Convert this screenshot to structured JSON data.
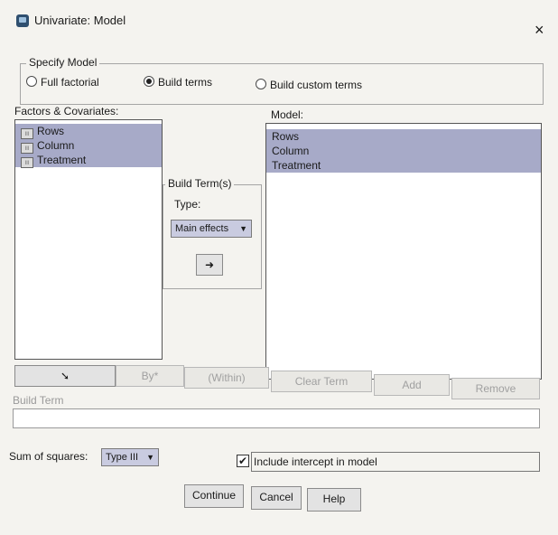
{
  "window": {
    "title": "Univariate: Model",
    "close_label": "×"
  },
  "specify_model": {
    "legend": "Specify Model",
    "options": [
      "Full factorial",
      "Build terms",
      "Build custom terms"
    ],
    "selected": "Build terms"
  },
  "factors": {
    "label": "Factors & Covariates:",
    "items": [
      "Rows",
      "Column",
      "Treatment"
    ]
  },
  "build_terms": {
    "legend": "Build Term(s)",
    "type_label": "Type:",
    "type_value": "Main effects",
    "arrow_label": "➜"
  },
  "model": {
    "label": "Model:",
    "items": [
      "Rows",
      "Column",
      "Treatment"
    ]
  },
  "term_buttons": {
    "down_arrow": "➘",
    "by": "By*",
    "within": "(Within)",
    "clear_term": "Clear Term",
    "add": "Add",
    "remove": "Remove"
  },
  "build_term_field": {
    "label": "Build Term",
    "value": ""
  },
  "sum_of_squares": {
    "label": "Sum of squares:",
    "value": "Type III"
  },
  "intercept": {
    "label": "Include intercept in model",
    "checked": true,
    "check_mark": "✔"
  },
  "footer": {
    "continue": "Continue",
    "cancel": "Cancel",
    "help": "Help"
  },
  "colors": {
    "selection": "#a7aac8",
    "dialog_bg": "#f4f3ef"
  }
}
